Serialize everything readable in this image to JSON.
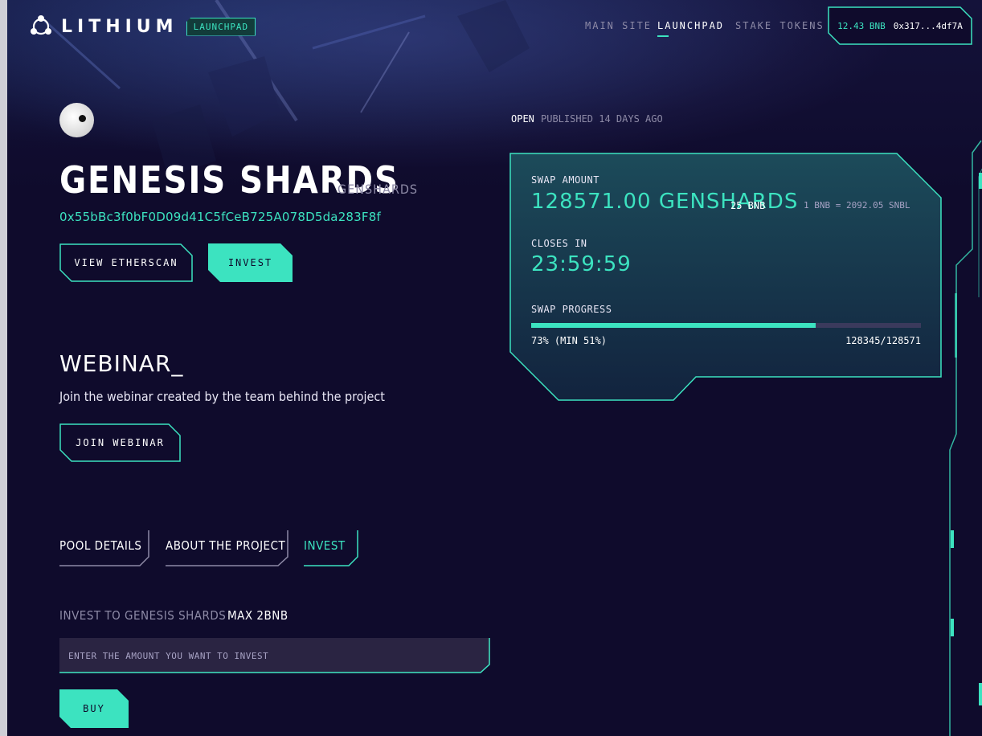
{
  "header": {
    "logo_text": "LITHIUM",
    "logo_badge": "LAUNCHPAD",
    "nav": [
      {
        "label": "MAIN SITE",
        "active": false
      },
      {
        "label": "LAUNCHPAD",
        "active": true
      },
      {
        "label": "STAKE TOKENS",
        "active": false
      }
    ],
    "wallet": {
      "balance": "12.43 BNB",
      "address": "0x317...4df7A"
    }
  },
  "project": {
    "name": "GENESIS SHARDS",
    "ticker": "GENSHARDS",
    "contract": "0x55bBc3f0bF0D09d41C5fCeB725A078D5da283F8f",
    "view_button": "VIEW ETHERSCAN",
    "invest_button": "INVEST"
  },
  "webinar": {
    "title": "WEBINAR_",
    "description": "Join the webinar created by the team behind the project",
    "button": "JOIN WEBINAR"
  },
  "tabs": [
    {
      "label": "POOL DETAILS",
      "active": false
    },
    {
      "label": "ABOUT THE PROJECT",
      "active": false
    },
    {
      "label": "INVEST",
      "active": true
    }
  ],
  "invest_form": {
    "label": "INVEST TO GENESIS SHARDS",
    "max": "MAX 2BNB",
    "placeholder": "ENTER THE AMOUNT YOU WANT TO INVEST",
    "buy_button": "BUY"
  },
  "status": {
    "state": "OPEN",
    "published": "PUBLISHED 14 DAYS AGO"
  },
  "swap": {
    "amount_label": "SWAP AMOUNT",
    "amount": "128571.00 GENSHARDS",
    "bnb": "25 BNB",
    "rate": "1 BNB = 2092.05 SNBL",
    "closes_label": "CLOSES IN",
    "countdown": "23:59:59",
    "progress_label": "SWAP PROGRESS",
    "progress_percent": 73,
    "progress_text": "73% (MIN 51%)",
    "progress_count": "128345/128571"
  },
  "colors": {
    "accent": "#3ce3c0",
    "background": "#0f0b2c",
    "muted": "#8d8aa6"
  },
  "icons": {
    "logo": "lithium-molecule-icon",
    "avatar": "genesis-shards-logo"
  }
}
